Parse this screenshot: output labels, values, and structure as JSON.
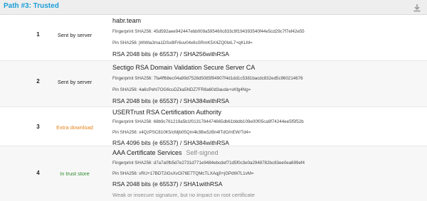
{
  "header": {
    "title": "Path #3: Trusted",
    "download_icon": "download-icon"
  },
  "colors": {
    "title": "#1a9ed6",
    "extra_download": "#e5831b",
    "in_trust_store": "#2e8b2e",
    "header_bg": "#eeeeee"
  },
  "rows": [
    {
      "num": "1",
      "status": "Sent by server",
      "name": "habr.team",
      "fingerprint": "Fingerprint SHA256: 45d592aee942447ebb009a595460c833c9f194393540f44e5cd29c7f7ef42e55",
      "pin": "Pin SHA256: jWWta3ma1DSx8lFr6uv04x6sSRmK5X4ZQ0lvlL7+qKLM=",
      "key": "RSA 2048 bits (e 65537) / SHA256withRSA"
    },
    {
      "num": "2",
      "status": "Sent by server",
      "name": "Sectigo RSA Domain Validation Secure Server CA",
      "fingerprint": "Fingerprint SHA256: 7fa4ff68ec04a99d7528d5085f94907f4d1dd1c5381bacdc832ed5c960214676",
      "pin": "Pin SHA256: 4a6cPehI7OG6cuDZka5NDZ7FR8a60d3auda+sKfg4Ng=",
      "key": "RSA 2048 bits (e 65537) / SHA384withRSA"
    },
    {
      "num": "3",
      "status": "Extra download",
      "name": "USERTrust RSA Certification Authority",
      "fingerprint": "Fingerprint SHA256: 68b9c761219a5b1f0131784474665db61bbdb109e00f05ca9f74244ee5f5f52b",
      "pin": "Pin SHA256: x4QzPSC810K5/cMjb05Qm4k3Bw5zBn4lTdO/nEW/Td4=",
      "key": "RSA 4096 bits (e 65537) / SHA384withRSA"
    },
    {
      "num": "4",
      "status": "In trust store",
      "name": "AAA Certificate Services",
      "self_signed": "Self-signed",
      "fingerprint": "Fingerprint SHA256: d7a7a0fb5d7e2731d771e9484ebcdef71d5f0c3e0a2948782bc83ee0ea699ef4",
      "pin": "Pin SHA256: vRU+17BDT2iGsXvOi76E7TQMcTLXAqj0+jGPdW7L1vM=",
      "key": "RSA 2048 bits (e 65537) / SHA1withRSA",
      "warning": "Weak or insecure signature, but no impact on root certificate"
    }
  ]
}
